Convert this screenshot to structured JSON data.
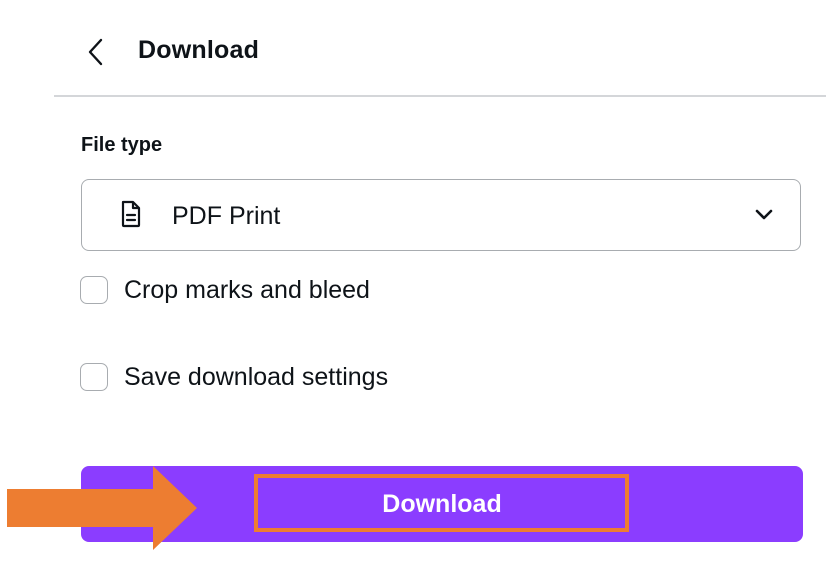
{
  "header": {
    "title": "Download",
    "back_icon": "chevron-left-icon"
  },
  "file_type": {
    "label": "File type",
    "selected_value": "PDF Print",
    "icon": "file-document-icon",
    "dropdown_icon": "chevron-down-icon"
  },
  "options": {
    "crop_marks_label": "Crop marks and bleed",
    "crop_marks_checked": false,
    "save_settings_label": "Save download settings",
    "save_settings_checked": false
  },
  "download_button": {
    "label": "Download",
    "background_color": "#8b3dff",
    "highlight_color": "#ed7d31"
  },
  "annotation": {
    "arrow_icon": "arrow-right-icon",
    "color": "#ed7d31"
  }
}
